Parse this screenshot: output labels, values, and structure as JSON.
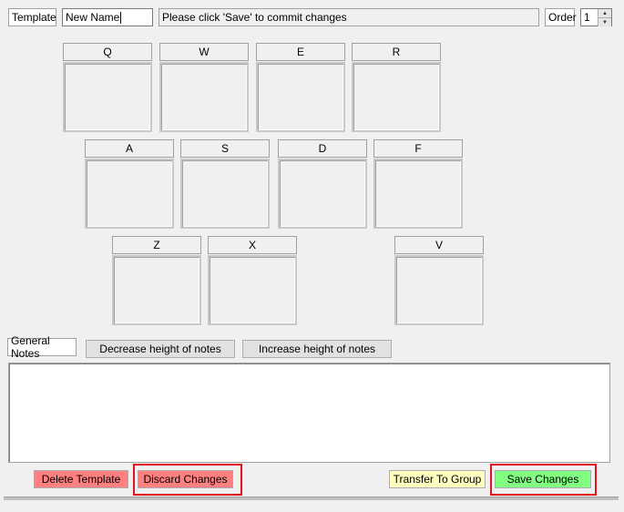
{
  "toolbar": {
    "template_label": "Template",
    "name_value": "New Name",
    "status_text": "Please click 'Save' to commit changes",
    "order_label": "Order",
    "order_value": "1"
  },
  "keys": {
    "row1": [
      "Q",
      "W",
      "E",
      "R"
    ],
    "row2": [
      "A",
      "S",
      "D",
      "F"
    ],
    "row3": [
      "Z",
      "X",
      "V"
    ]
  },
  "notes": {
    "label": "General Notes",
    "decrease_label": "Decrease height of notes",
    "increase_label": "Increase height of notes",
    "text": ""
  },
  "actions": {
    "delete_label": "Delete Template",
    "discard_label": "Discard Changes",
    "transfer_label": "Transfer To Group",
    "save_label": "Save Changes"
  },
  "colors": {
    "delete_bg": "#ff8080",
    "discard_bg": "#ff8080",
    "transfer_bg": "#ffffc0",
    "save_bg": "#80ff80",
    "highlight": "#e0141e"
  }
}
